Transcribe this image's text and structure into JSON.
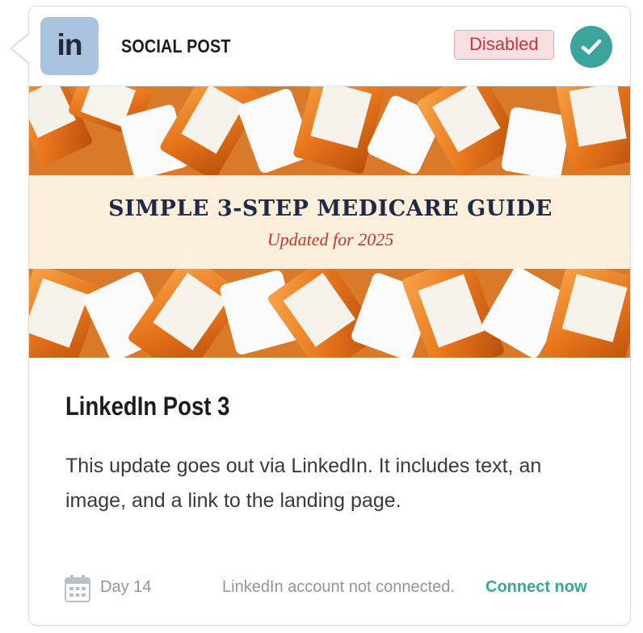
{
  "header": {
    "logo_text": "in",
    "post_type": "SOCIAL POST",
    "status_badge": "Disabled"
  },
  "banner": {
    "title": "SIMPLE 3-STEP MEDICARE GUIDE",
    "subtitle": "Updated for 2025"
  },
  "post": {
    "title": "LinkedIn Post 3",
    "description": "This update goes out via LinkedIn. It includes text, an image, and a link to the landing page."
  },
  "footer": {
    "day": "Day 14",
    "connection_message": "LinkedIn account not connected.",
    "connect_link": "Connect now"
  },
  "colors": {
    "accent": "#3ba59c",
    "badge_bg": "#f9dfe1",
    "badge_text": "#c5343f",
    "logo_bg": "#a9c2dd"
  },
  "icons": {
    "check": "check-icon",
    "calendar": "calendar-icon",
    "logo": "linkedin-logo-icon"
  }
}
